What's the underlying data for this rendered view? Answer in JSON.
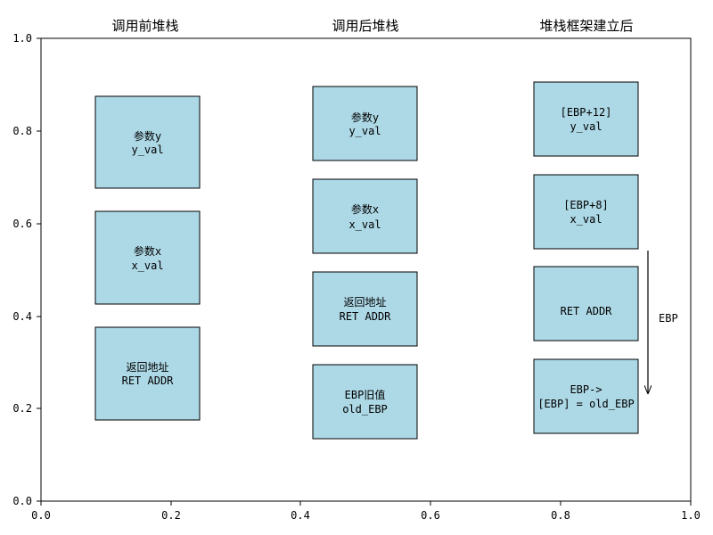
{
  "axes": {
    "xlim": [
      0,
      1
    ],
    "ylim": [
      0,
      1
    ],
    "x_ticks": [
      "0.0",
      "0.2",
      "0.4",
      "0.6",
      "0.8",
      "1.0"
    ],
    "y_ticks": [
      "0.0",
      "0.2",
      "0.4",
      "0.6",
      "0.8",
      "1.0"
    ],
    "grid": false
  },
  "colors": {
    "box_fill": "#add8e6",
    "box_stroke": "#000000",
    "text": "#000000"
  },
  "panels": [
    {
      "title": "调用前堆栈",
      "boxes": [
        {
          "line1": "参数y",
          "line2": "y_val"
        },
        {
          "line1": "参数x",
          "line2": "x_val"
        },
        {
          "line1": "返回地址",
          "line2": "RET ADDR"
        }
      ]
    },
    {
      "title": "调用后堆栈",
      "boxes": [
        {
          "line1": "参数y",
          "line2": "y_val"
        },
        {
          "line1": "参数x",
          "line2": "x_val"
        },
        {
          "line1": "返回地址",
          "line2": "RET ADDR"
        },
        {
          "line1": "EBP旧值",
          "line2": "old_EBP"
        }
      ]
    },
    {
      "title": "堆栈框架建立后",
      "boxes": [
        {
          "line1": "[EBP+12]",
          "line2": "y_val"
        },
        {
          "line1": "[EBP+8]",
          "line2": "x_val"
        },
        {
          "line1": "RET ADDR",
          "line2": ""
        },
        {
          "line1": "EBP->",
          "line2": "[EBP] = old_EBP"
        }
      ]
    }
  ],
  "annotation": {
    "label": "EBP",
    "arrow_direction": "down"
  }
}
